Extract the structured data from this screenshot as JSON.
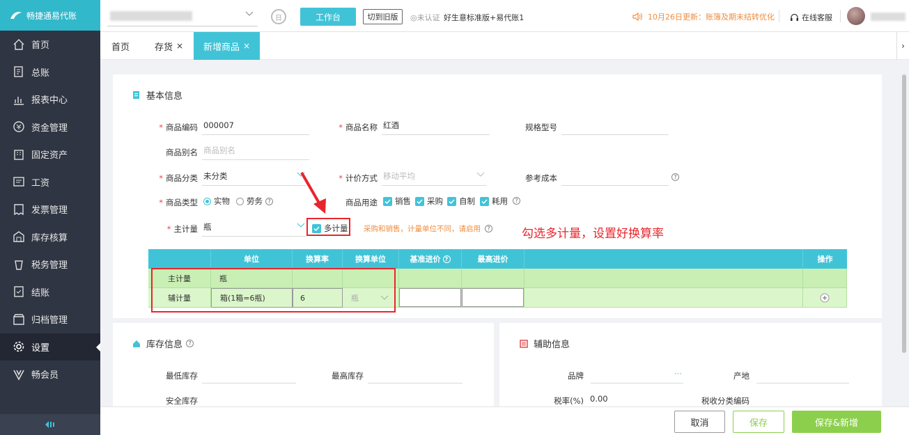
{
  "app": {
    "title": "畅捷通易代账"
  },
  "nav": {
    "items": [
      {
        "label": "首页",
        "icon": "home-icon"
      },
      {
        "label": "总账",
        "icon": "ledger-icon"
      },
      {
        "label": "报表中心",
        "icon": "chart-icon"
      },
      {
        "label": "资金管理",
        "icon": "money-icon"
      },
      {
        "label": "固定资产",
        "icon": "building-icon"
      },
      {
        "label": "工资",
        "icon": "salary-icon"
      },
      {
        "label": "发票管理",
        "icon": "invoice-icon"
      },
      {
        "label": "库存核算",
        "icon": "warehouse-icon"
      },
      {
        "label": "税务管理",
        "icon": "tax-icon"
      },
      {
        "label": "结账",
        "icon": "close-books-icon"
      },
      {
        "label": "归档管理",
        "icon": "archive-icon"
      },
      {
        "label": "设置",
        "icon": "gear-icon"
      },
      {
        "label": "畅会员",
        "icon": "vip-icon"
      }
    ],
    "active_index": 11
  },
  "topbar": {
    "workbench": "工作台",
    "switch_old": "切到旧版",
    "cert": "未认证",
    "plan": "好生意标准版+易代账1",
    "news": "10月26日更新：账簿及期末结转优化",
    "service": "在线客服"
  },
  "tabs": [
    {
      "label": "首页",
      "closable": false
    },
    {
      "label": "存货",
      "closable": true
    },
    {
      "label": "新增商品",
      "closable": true,
      "active": true
    }
  ],
  "basic": {
    "title": "基本信息",
    "code": {
      "label": "商品编码",
      "value": "000007"
    },
    "name": {
      "label": "商品名称",
      "value": "红酒"
    },
    "spec": {
      "label": "规格型号",
      "value": ""
    },
    "alias": {
      "label": "商品别名",
      "placeholder": "商品别名"
    },
    "category": {
      "label": "商品分类",
      "value": "未分类"
    },
    "pricing": {
      "label": "计价方式",
      "value": "移动平均"
    },
    "ref_cost": {
      "label": "参考成本",
      "value": ""
    },
    "type": {
      "label": "商品类型",
      "options": [
        "实物",
        "劳务"
      ],
      "selected": "实物"
    },
    "usage": {
      "label": "商品用途",
      "options": [
        "销售",
        "采购",
        "自制",
        "耗用"
      ]
    },
    "main_unit": {
      "label": "主计量",
      "value": "瓶"
    },
    "multi_unit": {
      "label": "多计量",
      "checked": true
    },
    "hint": "采购和销售，计量单位不同，请启用"
  },
  "annotation": "勾选多计量，设置好换算率",
  "unit_table": {
    "headers": [
      "",
      "单位",
      "换算率",
      "换算单位",
      "基准进价",
      "最高进价",
      "",
      "操作"
    ],
    "rows": [
      {
        "type": "主计量",
        "unit": "瓶",
        "rate": "",
        "conv_unit": ""
      },
      {
        "type": "辅计量",
        "unit": "箱(1箱=6瓶)",
        "rate": "6",
        "conv_unit": "瓶"
      }
    ]
  },
  "stock": {
    "title": "库存信息",
    "min": "最低库存",
    "max": "最高库存",
    "safe": "安全库存"
  },
  "aux": {
    "title": "辅助信息",
    "brand": "品牌",
    "origin": "产地",
    "tax_rate_label": "税率(%)",
    "tax_rate": "0.00",
    "tax_code": "税收分类编码",
    "brand_more": "···"
  },
  "footer": {
    "cancel": "取消",
    "save": "保存",
    "save_new": "保存&新增"
  }
}
